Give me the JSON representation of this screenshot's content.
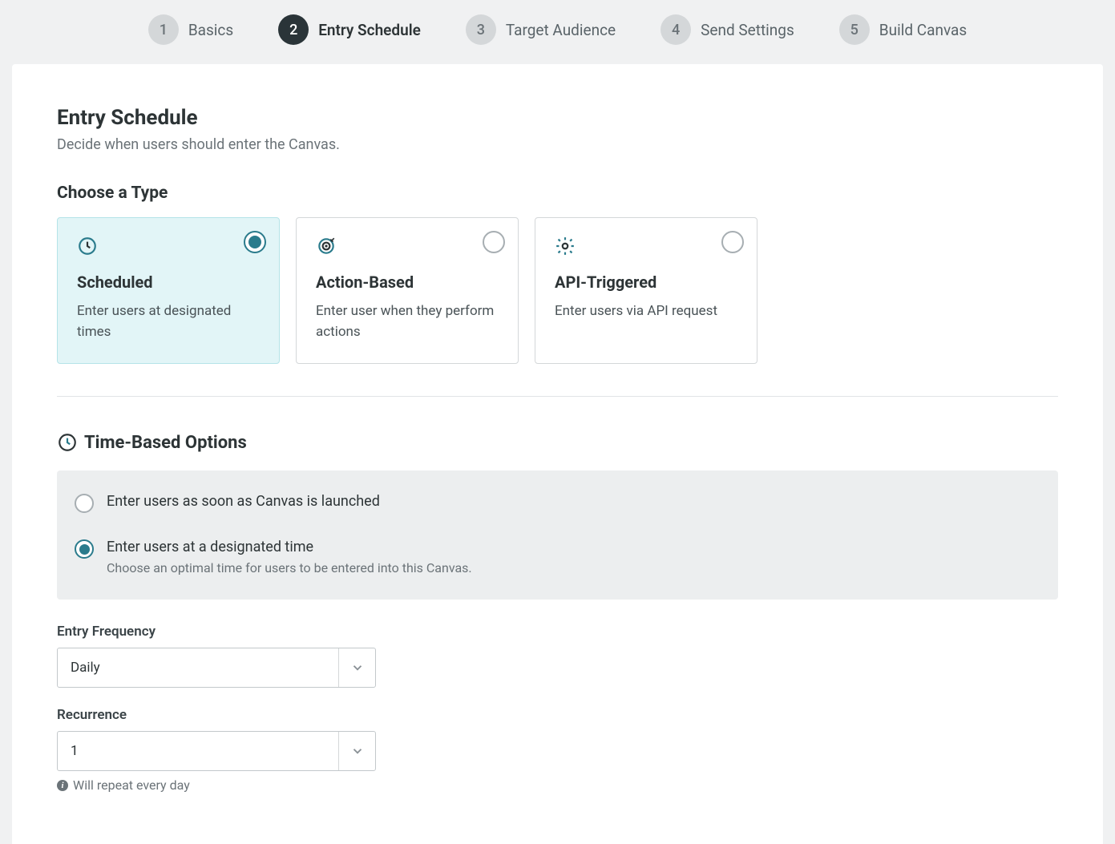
{
  "stepper": [
    {
      "num": "1",
      "label": "Basics",
      "active": false
    },
    {
      "num": "2",
      "label": "Entry Schedule",
      "active": true
    },
    {
      "num": "3",
      "label": "Target Audience",
      "active": false
    },
    {
      "num": "4",
      "label": "Send Settings",
      "active": false
    },
    {
      "num": "5",
      "label": "Build Canvas",
      "active": false
    }
  ],
  "page": {
    "title": "Entry Schedule",
    "subtitle": "Decide when users should enter the Canvas."
  },
  "chooseType": {
    "heading": "Choose a Type",
    "cards": [
      {
        "title": "Scheduled",
        "desc": "Enter users at designated times",
        "selected": true,
        "icon": "clock"
      },
      {
        "title": "Action-Based",
        "desc": "Enter user when they perform actions",
        "selected": false,
        "icon": "target"
      },
      {
        "title": "API-Triggered",
        "desc": "Enter users via API request",
        "selected": false,
        "icon": "gear"
      }
    ]
  },
  "timeOptions": {
    "heading": "Time-Based Options",
    "radios": [
      {
        "label": "Enter users as soon as Canvas is launched",
        "sub": "",
        "selected": false
      },
      {
        "label": "Enter users at a designated time",
        "sub": "Choose an optimal time for users to be entered into this Canvas.",
        "selected": true
      }
    ]
  },
  "entryFrequency": {
    "label": "Entry Frequency",
    "value": "Daily"
  },
  "recurrence": {
    "label": "Recurrence",
    "value": "1",
    "help": "Will repeat every day"
  }
}
